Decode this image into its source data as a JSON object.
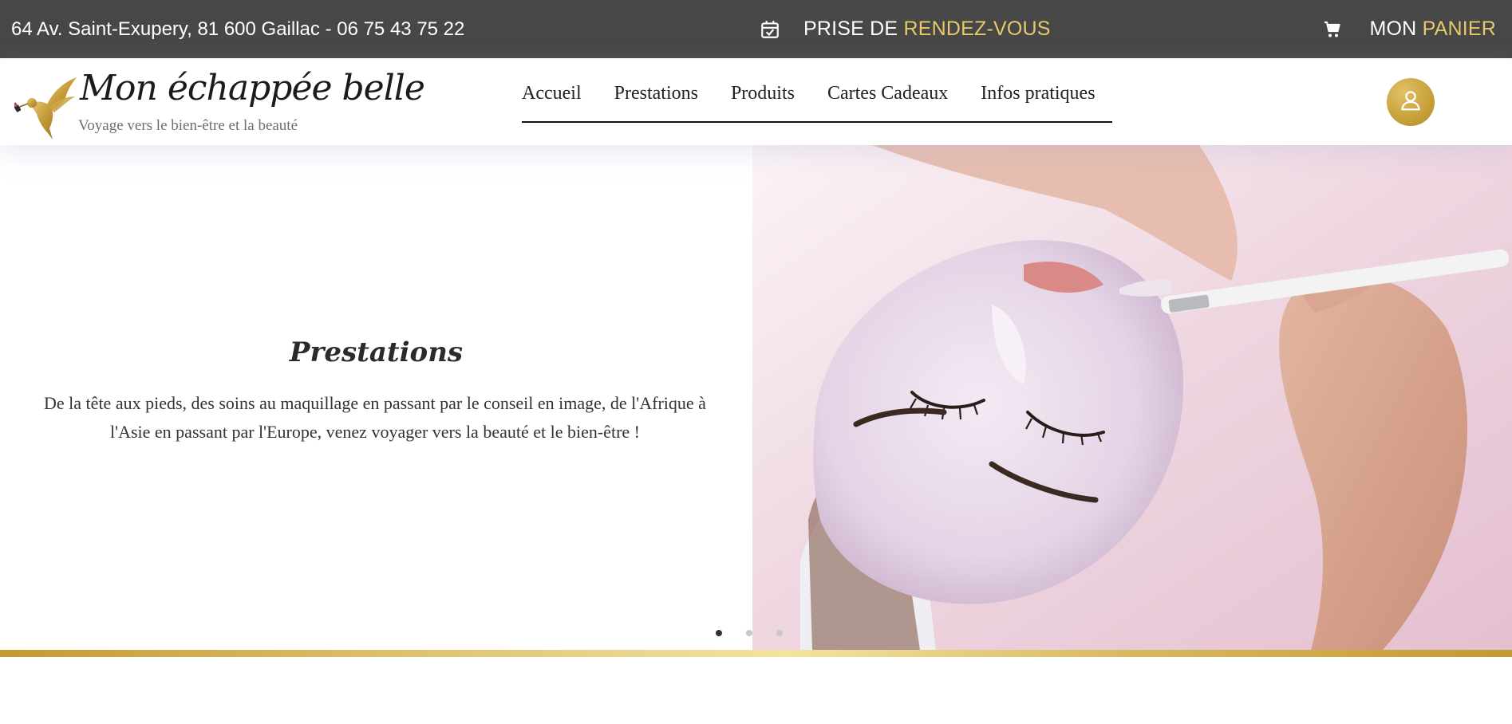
{
  "topbar": {
    "address": "64 Av. Saint-Exupery, 81 600 Gaillac - 06 75 43 75 22",
    "booking": {
      "prefix": "PRISE DE",
      "highlight": "RENDEZ-VOUS",
      "icon": "calendar-check-icon"
    },
    "cart": {
      "prefix": "MON",
      "highlight": "PANIER",
      "icon": "shopping-cart-icon"
    }
  },
  "header": {
    "brand": "Mon échappée belle",
    "tagline": "Voyage vers le bien-être et la beauté",
    "nav": [
      "Accueil",
      "Prestations",
      "Produits",
      "Cartes Cadeaux",
      "Infos pratiques"
    ],
    "account_icon": "user-icon"
  },
  "hero": {
    "title": "Prestations",
    "description": "De la tête aux pieds, des soins au maquillage en passant par le conseil en image, de l'Afrique à l'Asie en passant par l'Europe, venez voyager vers la beauté et le bien-être !",
    "active_slide": 1,
    "slides": 3
  },
  "colors": {
    "topbar_bg": "#474747",
    "accent": "#e7c86a",
    "gold": "#c9a33c"
  }
}
